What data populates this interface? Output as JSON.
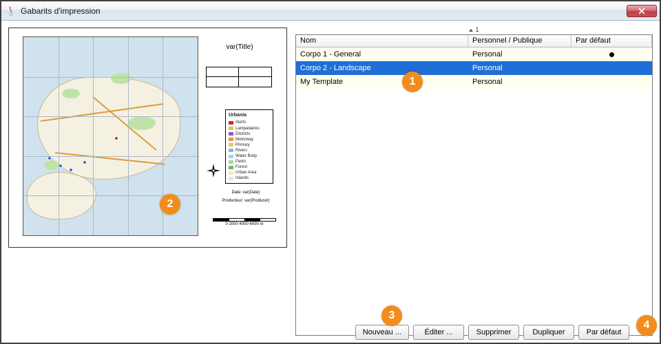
{
  "window": {
    "title": "Gabarits d'impression",
    "close_label": "Close"
  },
  "preview": {
    "title_var": "var(Title)",
    "date_line": "Date: var(Date)",
    "producer_line": "Producteur: var(Producer)",
    "scale_label": "0    2000   4000 6000 m",
    "legend_title": "Urbania",
    "legend_items": [
      {
        "label": "Alerts",
        "color": "#d22"
      },
      {
        "label": "Lampadaires",
        "color": "#cc6"
      },
      {
        "label": "Districts",
        "color": "#95b"
      },
      {
        "label": "Motorway",
        "color": "#e79a3a"
      },
      {
        "label": "Primary",
        "color": "#ecc46a"
      },
      {
        "label": "Rivers",
        "color": "#7fb7e6"
      },
      {
        "label": "Water Body",
        "color": "#a8cfee"
      },
      {
        "label": "Parks",
        "color": "#a9d98a"
      },
      {
        "label": "Forest",
        "color": "#7cb66a"
      },
      {
        "label": "Urban Area",
        "color": "#f0e8c8"
      },
      {
        "label": "Islands",
        "color": "#ece6c6"
      }
    ]
  },
  "table": {
    "page_indicator": "1",
    "columns": {
      "nom": "Nom",
      "personnel_publique": "Personnel / Publique",
      "par_defaut": "Par défaut"
    },
    "rows": [
      {
        "nom": "Corpo 1 - General",
        "pp": "Personal",
        "default": true,
        "selected": false
      },
      {
        "nom": "Corpo 2 - Landscape",
        "pp": "Personal",
        "default": false,
        "selected": true
      },
      {
        "nom": "My Template",
        "pp": "Personal",
        "default": false,
        "selected": false
      }
    ]
  },
  "buttons": {
    "nouveau": "Nouveau ...",
    "editer": "Éditer ...",
    "supprimer": "Supprimer",
    "dupliquer": "Dupliquer",
    "par_defaut": "Par défaut"
  },
  "badges": {
    "b1": "1",
    "b2": "2",
    "b3": "3",
    "b4": "4"
  }
}
